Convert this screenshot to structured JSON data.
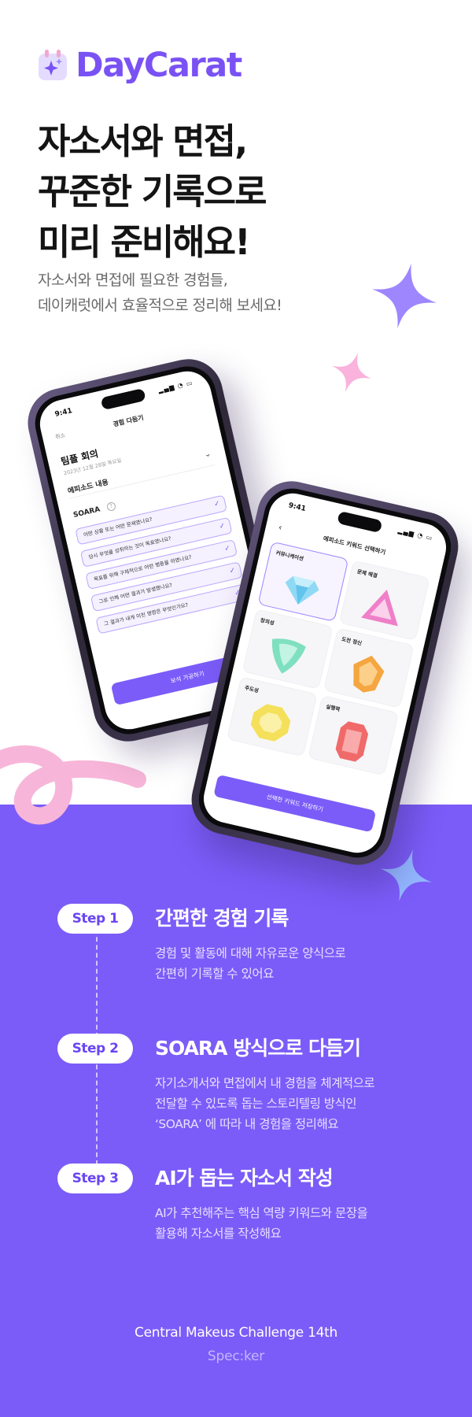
{
  "brand": {
    "name": "DayCarat",
    "accent_color": "#7a52f4",
    "section_color": "#7b5cf8",
    "pink": "#f7b6d9",
    "star_purple": "#9e86ff",
    "star_blue": "#93b7ff"
  },
  "hero": {
    "headline": [
      "자소서와 면접,",
      "꾸준한 기록으로",
      "미리 준비해요!"
    ],
    "subcopy": [
      "자소서와 면접에 필요한 경험들,",
      "데이캐럿에서 효율적으로 정리해 보세요!"
    ]
  },
  "phone_left": {
    "status_time": "9:41",
    "cancel": "취소",
    "title": "경험 다듬기",
    "meeting": "팀플 회의",
    "date": "2023년 12월 28일 목요일",
    "episode": "에피소드 내용",
    "soara_label": "SOARA",
    "questions": [
      "어떤 상황 또는 어떤 문제였나요?",
      "당시 무엇을 성취하는 것이 목표였나요?",
      "목표를 위해 구체적으로 어떤 행동을 하였나요?",
      "그로 인해 어떤 결과가 발생했나요?",
      "그 결과가 내게 미친 영향은 무엇인가요?"
    ],
    "save_button": "보석 가공하기"
  },
  "phone_right": {
    "status_time": "9:41",
    "back": "‹",
    "title": "에피소드 키워드 선택하기",
    "gems": [
      {
        "label": "커뮤니케이션",
        "color": "#8fd9f5",
        "icon": "diamond-icon",
        "selected": true
      },
      {
        "label": "문제 해결",
        "color": "#ef7fc8",
        "icon": "triangle-gem-icon",
        "selected": false
      },
      {
        "label": "창의성",
        "color": "#7fe0c0",
        "icon": "trillion-gem-icon",
        "selected": false
      },
      {
        "label": "도전 정신",
        "color": "#f5a640",
        "icon": "orange-gem-icon",
        "selected": false
      },
      {
        "label": "주도성",
        "color": "#f4e05a",
        "icon": "yellow-gem-icon",
        "selected": false
      },
      {
        "label": "실행력",
        "color": "#f06a6a",
        "icon": "ruby-gem-icon",
        "selected": false
      }
    ],
    "save_button": "선택한 키워드 저장하기"
  },
  "steps": [
    {
      "pill": "Step 1",
      "title": "간편한 경험 기록",
      "desc": [
        "경험 및 활동에 대해 자유로운 양식으로",
        "간편히 기록할 수 있어요"
      ]
    },
    {
      "pill": "Step 2",
      "title": "SOARA 방식으로 다듬기",
      "desc": [
        "자기소개서와 면접에서 내 경험을 체계적으로",
        "전달할 수 있도록 돕는 스토리텔링 방식인",
        "‘SOARA’ 에 따라 내 경험을 정리해요"
      ]
    },
    {
      "pill": "Step 3",
      "title": "AI가 돕는 자소서 작성",
      "desc": [
        "AI가 추천해주는 핵심 역량 키워드와 문장을",
        "활용해 자소서를 작성해요"
      ]
    }
  ],
  "footer": {
    "line1": "Central Makeus Challenge 14th",
    "line2": "Spec:ker"
  }
}
